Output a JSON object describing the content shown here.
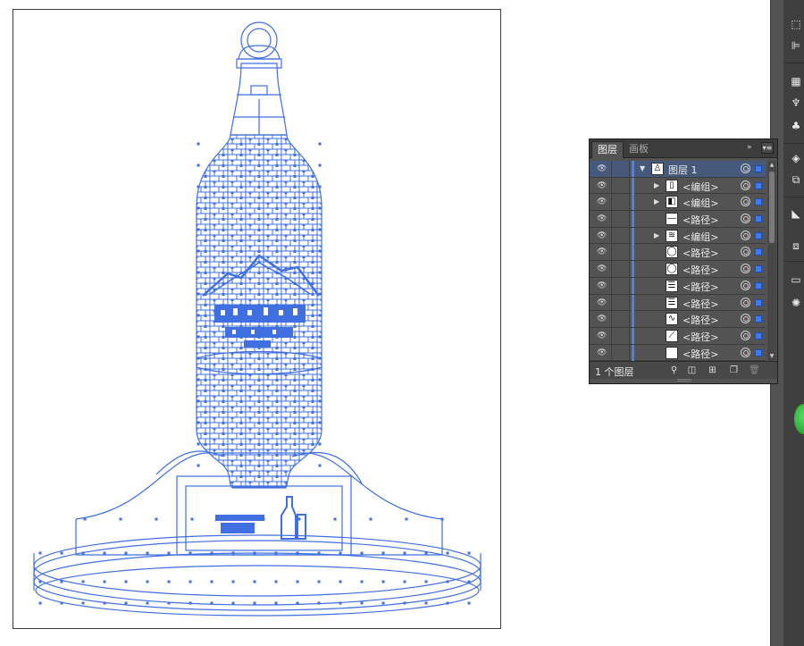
{
  "layers_panel": {
    "tabs": [
      {
        "label": "图层",
        "active": true
      },
      {
        "label": "画板",
        "active": false
      }
    ],
    "collapse_glyph": "»",
    "menu_glyph": "▾≡",
    "rows": [
      {
        "label": "图层 1",
        "expand": "▼",
        "thumb_icon": "figure-icon",
        "selected": true
      },
      {
        "label": "<编组>",
        "expand": "▶",
        "thumb_icon": "bottle-icon",
        "selected": false
      },
      {
        "label": "<编组>",
        "expand": "▶",
        "thumb_icon": "shape-icon",
        "selected": false
      },
      {
        "label": "<路径>",
        "expand": "",
        "thumb_icon": "line-icon",
        "selected": false
      },
      {
        "label": "<编组>",
        "expand": "▶",
        "thumb_icon": "band-icon",
        "selected": false
      },
      {
        "label": "<路径>",
        "expand": "",
        "thumb_icon": "circle-icon",
        "selected": false
      },
      {
        "label": "<路径>",
        "expand": "",
        "thumb_icon": "circle-icon",
        "selected": false
      },
      {
        "label": "<路径>",
        "expand": "",
        "thumb_icon": "lines-icon",
        "selected": false
      },
      {
        "label": "<路径>",
        "expand": "",
        "thumb_icon": "lines-icon",
        "selected": false
      },
      {
        "label": "<路径>",
        "expand": "",
        "thumb_icon": "wave-icon",
        "selected": false
      },
      {
        "label": "<路径>",
        "expand": "",
        "thumb_icon": "diagonal-icon",
        "selected": false
      },
      {
        "label": "<路径>",
        "expand": "",
        "thumb_icon": "blank-icon",
        "selected": false
      }
    ],
    "footer": {
      "layer_count": "1 个图层"
    }
  },
  "colors": {
    "selection_blue": "#4f7fe0",
    "panel_bg": "#535353",
    "panel_dark": "#3c3c3c",
    "artwork_stroke": "#3f6fe0"
  }
}
